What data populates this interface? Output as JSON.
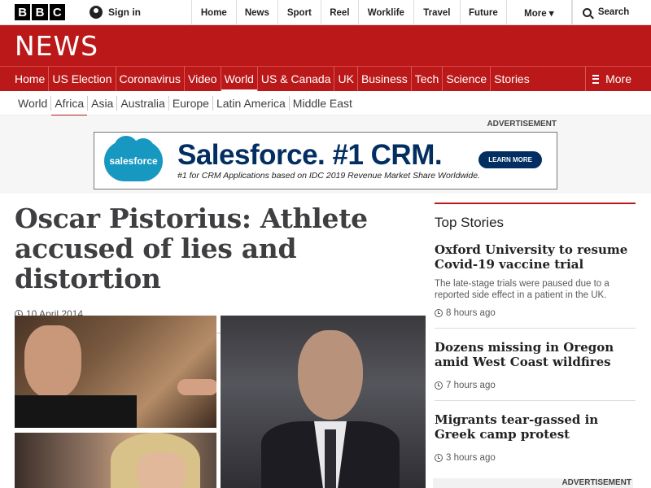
{
  "topbar": {
    "logo_letters": [
      "B",
      "B",
      "C"
    ],
    "signin_label": "Sign in",
    "nav": [
      {
        "label": "Home"
      },
      {
        "label": "News"
      },
      {
        "label": "Sport"
      },
      {
        "label": "Reel"
      },
      {
        "label": "Worklife"
      },
      {
        "label": "Travel"
      },
      {
        "label": "Future"
      },
      {
        "label": "More ▾"
      }
    ],
    "search_label": "Search"
  },
  "banner": {
    "wordmark": "NEWS"
  },
  "section_nav": {
    "items": [
      "Home",
      "US Election",
      "Coronavirus",
      "Video",
      "World",
      "US & Canada",
      "UK",
      "Business",
      "Tech",
      "Science",
      "Stories"
    ],
    "active": "World",
    "more_label": "More"
  },
  "sub_nav": {
    "items": [
      "World",
      "Africa",
      "Asia",
      "Australia",
      "Europe",
      "Latin America",
      "Middle East"
    ],
    "active": "Africa"
  },
  "advert": {
    "label": "ADVERTISEMENT",
    "brand": "salesforce",
    "headline": "Salesforce. #1 CRM.",
    "subline": "#1 for CRM Applications based on IDC 2019 Revenue Market Share Worldwide.",
    "button": "LEARN MORE"
  },
  "article": {
    "headline": "Oscar Pistorius: Athlete accused of lies and distortion",
    "date": "10 April 2014"
  },
  "top_stories": {
    "heading": "Top Stories",
    "stories": [
      {
        "title": "Oxford University to resume Covid-19 vaccine trial",
        "summary": "The late-stage trials were paused due to a reported side effect in a patient in the UK.",
        "time": "8 hours ago"
      },
      {
        "title": "Dozens missing in Oregon amid West Coast wildfires",
        "summary": "",
        "time": "7 hours ago"
      },
      {
        "title": "Migrants tear-gassed in Greek camp protest",
        "summary": "",
        "time": "3 hours ago"
      }
    ]
  },
  "bottom_advert_label": "ADVERTISEMENT",
  "colors": {
    "brand_red": "#bb1919",
    "salesforce_blue": "#1798c1",
    "salesforce_navy": "#032e61"
  },
  "icons": [
    "bbc-logo",
    "user-icon",
    "search-icon",
    "menu-icon",
    "clock-icon"
  ]
}
